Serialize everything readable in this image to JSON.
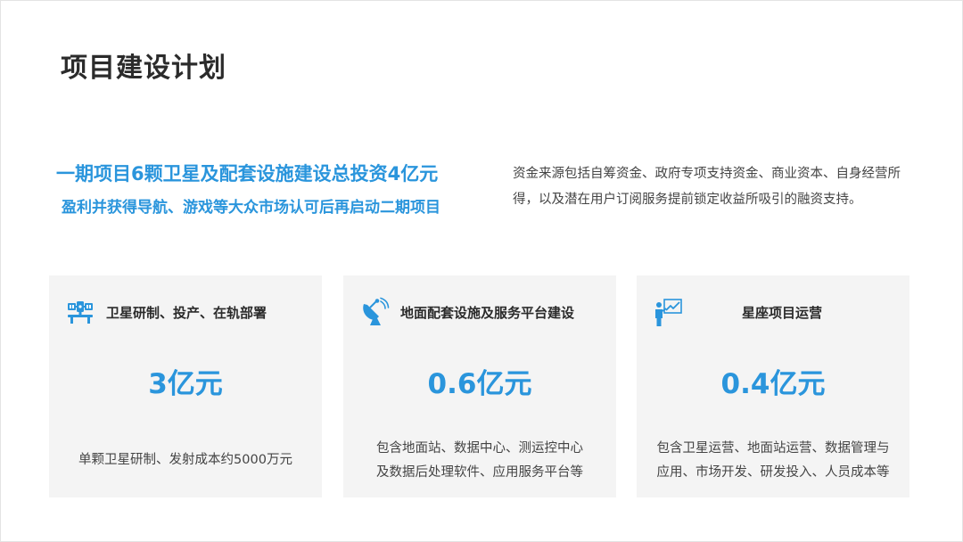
{
  "title": "项目建设计划",
  "headline": {
    "line1": "一期项目6颗卫星及配套设施建设总投资4亿元",
    "line2": "盈利并获得导航、游戏等大众市场认可后再启动二期项目"
  },
  "funding": {
    "text": "资金来源包括自筹资金、政府专项支持资金、商业资本、自身经营所得，以及潜在用户订阅服务提前锁定收益所吸引的融资支持。"
  },
  "colors": {
    "accent": "#2a95dc",
    "card_bg": "#f4f4f4",
    "title": "#2b2b2b"
  },
  "cards": [
    {
      "icon": "satellite-icon",
      "title": "卫星研制、投产、在轨部署",
      "amount": "3亿元",
      "desc_lines": [
        "单颗卫星研制、发射成本约5000万元"
      ]
    },
    {
      "icon": "satellite-dish-icon",
      "title": "地面配套设施及服务平台建设",
      "amount": "0.6亿元",
      "desc_lines": [
        "包含地面站、数据中心、测运控中心",
        "及数据后处理软件、应用服务平台等"
      ]
    },
    {
      "icon": "presentation-chart-icon",
      "title": "星座项目运营",
      "amount": "0.4亿元",
      "desc_lines": [
        "包含卫星运营、地面站运营、数据管理与",
        "应用、市场开发、研发投入、人员成本等"
      ]
    }
  ]
}
